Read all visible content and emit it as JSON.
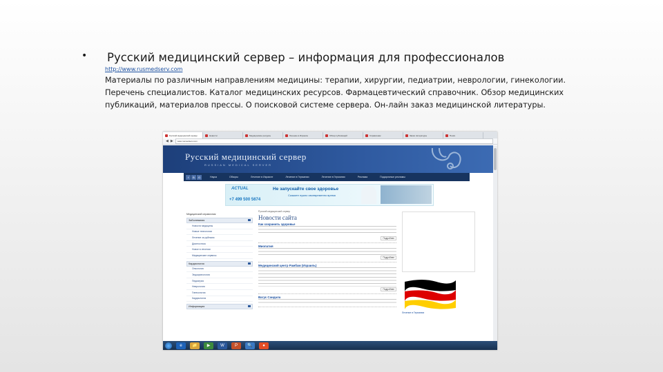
{
  "slide": {
    "bullet": "•",
    "title": "Русский медицинский сервер – информация для профессионалов",
    "url": "http://www.rusmedserv.com",
    "description": "Материалы по различным направлениям медицины: терапии, хирургии, педиатрии, неврологии, гинекологии. Перечень специалистов. Каталог медицинских ресурсов. Фармацевтический справочник. Обзор медицинских публикаций, материалов прессы. О поисковой системе сервера. Он-лайн заказ медицинской литературы."
  },
  "browser": {
    "tabs": [
      "Русский медицинский сервер",
      "Новости",
      "Медицинские ресурсы",
      "Лечение в Израиле",
      "Обзор публикаций",
      "Справочник",
      "Заказ литературы",
      "Поиск"
    ],
    "address": "www.rusmedserv.com",
    "nav_back": "◀",
    "nav_forward": "▶"
  },
  "site": {
    "title": "Русский медицинский сервер",
    "subtitle": "RUSSIAN MEDICAL SERVER",
    "social": [
      "f",
      "В",
      "G"
    ],
    "nav": [
      "Наука",
      "Обзоры",
      "Лечение в Израиле",
      "Лечение в Германии",
      "Лечение в Германии",
      "Реклама",
      "Подарочные рекламы"
    ],
    "ad": {
      "logo": "ACTUAL",
      "phone": "+7 499 500 5674",
      "headline": "Не запускайте свое здоровье",
      "sub": "Скажите нужно своевременно время"
    },
    "left": {
      "top_link": "Медицинский справочник",
      "sections": [
        {
          "head": "Заболевания",
          "items": [
            "Новости медицины",
            "Новые технологии",
            "Лечение за рубежом",
            "Диагностика",
            "Новое в лечении",
            "Медицинские сервисы"
          ]
        },
        {
          "head": "Кардиология",
          "items": [
            "Онкология",
            "Эндокринология",
            "Педиатрия",
            "Неврология",
            "Гинекология",
            "Кардиология"
          ]
        },
        {
          "head": "Информация",
          "items": []
        }
      ]
    },
    "center": {
      "breadcrumb": "Русский медицинский сервер",
      "heading": "Новости сайта",
      "articles": [
        {
          "title": "Как сохранить здоровье",
          "text": "",
          "date": "",
          "more": "Подробнее"
        },
        {
          "title": "Миопатия",
          "text": "",
          "date": "",
          "more": "Подробнее"
        },
        {
          "title": "Медицинский центр Рамбам (Израиль)",
          "text": "",
          "date": "",
          "more": "Подробнее"
        },
        {
          "title": "Вагус Сандала",
          "text": "",
          "date": "",
          "more": "Подробнее"
        }
      ]
    },
    "right": {
      "caption": "Лечение в Германии",
      "caption_sub": ""
    }
  },
  "taskbar": {
    "icons": [
      "e",
      "📁",
      "▶",
      "W",
      "P",
      "🔍",
      "●"
    ],
    "tray_time": "",
    "tray_date": ""
  },
  "colors": {
    "banner": "#2f5aa0",
    "nav": "#17345f",
    "link": "#1a4fa0",
    "flag_black": "#000000",
    "flag_red": "#dd0000",
    "flag_gold": "#ffce00"
  }
}
